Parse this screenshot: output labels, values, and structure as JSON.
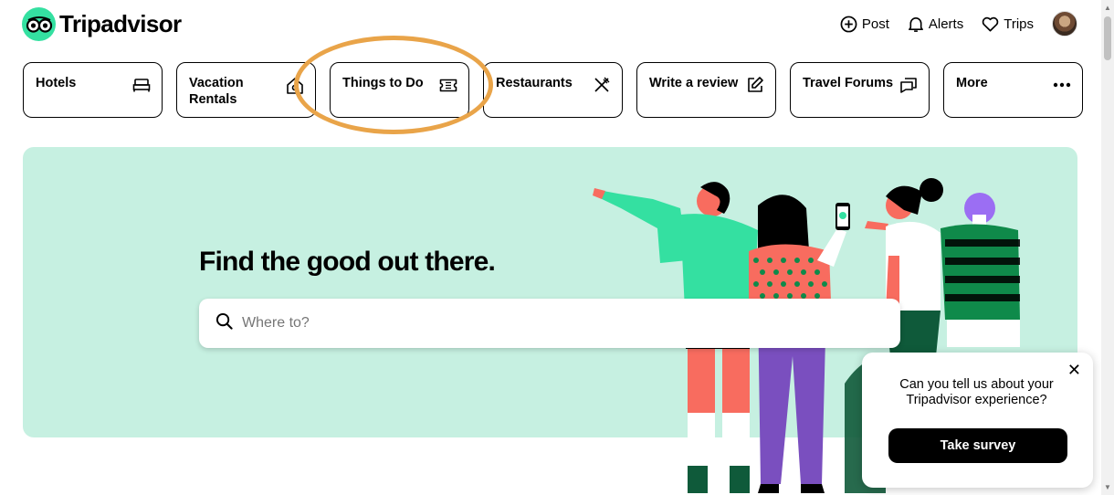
{
  "header": {
    "logo_text": "Tripadvisor",
    "actions": [
      {
        "label": "Post",
        "icon": "plus-circle-icon"
      },
      {
        "label": "Alerts",
        "icon": "bell-icon"
      },
      {
        "label": "Trips",
        "icon": "heart-icon"
      }
    ],
    "avatar": "user-avatar"
  },
  "nav": {
    "items": [
      {
        "label": "Hotels",
        "icon": "bed-icon"
      },
      {
        "label": "Vacation Rentals",
        "icon": "house-icon"
      },
      {
        "label": "Things to Do",
        "icon": "ticket-icon"
      },
      {
        "label": "Restaurants",
        "icon": "fork-knife-icon"
      },
      {
        "label": "Write a review",
        "icon": "edit-icon"
      },
      {
        "label": "Travel Forums",
        "icon": "chat-icon"
      },
      {
        "label": "More",
        "icon": "more-dots-icon"
      }
    ],
    "highlighted": "Things to Do"
  },
  "hero": {
    "title": "Find the good out there.",
    "search_placeholder": "Where to?"
  },
  "survey": {
    "text": "Can you tell us about your Tripadvisor experience?",
    "button": "Take survey"
  },
  "colors": {
    "brand": "#34e0a1",
    "hero_bg": "#c6f0e1",
    "highlight_ring": "#e9a449"
  }
}
